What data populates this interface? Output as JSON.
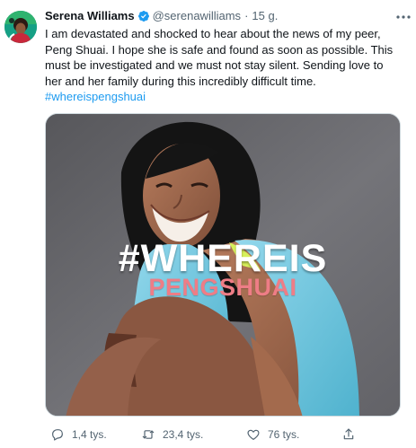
{
  "tweet": {
    "author_name": "Serena Williams",
    "author_handle": "@serenawilliams",
    "separator": "·",
    "time": "15 g.",
    "text_main": "I am devastated and shocked to hear about the news of my peer, Peng Shuai. I hope she is safe and found as soon as possible. This must be investigated and we must not stay silent. Sending love to her and her family during this incredibly difficult time. ",
    "hashtag": "#whereispengshuai"
  },
  "media": {
    "headline": "#WHEREIS",
    "subheadline": "PENGSHUAI"
  },
  "actions": {
    "reply_count": "1,4 tys.",
    "retweet_count": "23,4 tys.",
    "like_count": "76 tys."
  },
  "colors": {
    "verified_badge": "#1d9bf0",
    "link": "#1d9bf0",
    "secondary_text": "#536471",
    "subheadline": "#ee7d86"
  },
  "icons": {
    "avatar": "profile-avatar",
    "verified": "verified-badge-icon",
    "more": "more-options-icon",
    "reply": "reply-icon",
    "retweet": "retweet-icon",
    "like": "heart-icon",
    "share": "share-icon"
  }
}
